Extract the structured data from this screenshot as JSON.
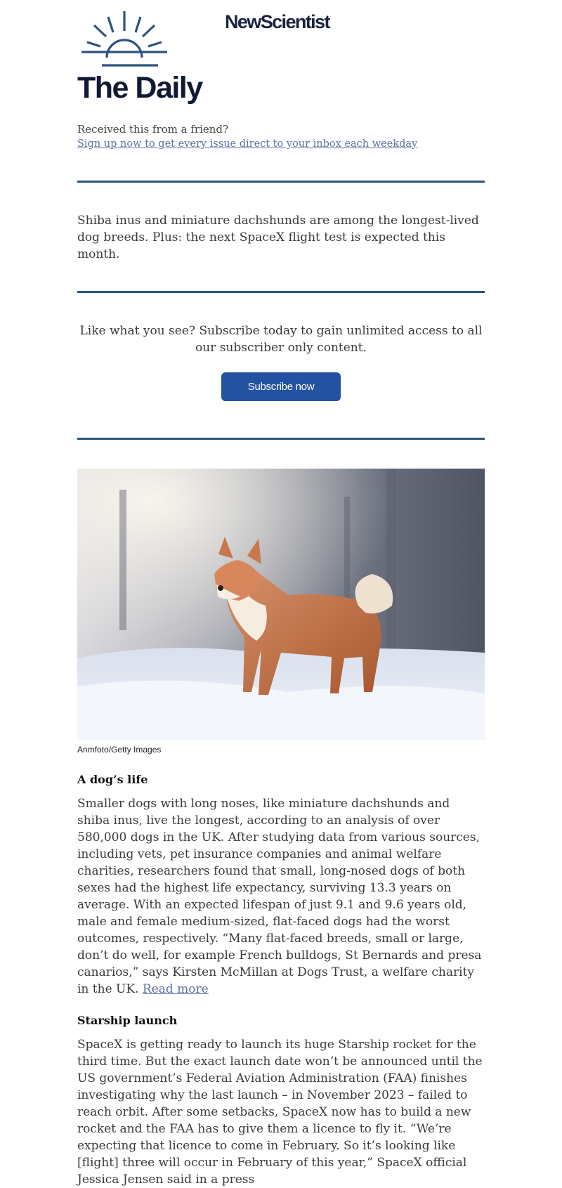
{
  "brand": {
    "name": "NewScientist",
    "logo_icon": "sunrise-icon",
    "accent": "#2b537e"
  },
  "newsletter": {
    "title": "The Daily"
  },
  "forward": {
    "question": "Received this from a friend?",
    "signup_link": "Sign up now to get every issue direct to your inbox each weekday"
  },
  "intro": "Shiba inus and miniature dachshunds are among the longest-lived dog breeds. Plus: the next SpaceX flight test is expected this month.",
  "subscribe": {
    "text": "Like what you see? Subscribe today to gain unlimited access to all our subscriber only content.",
    "button_label": "Subscribe now",
    "button_color": "#2352a2"
  },
  "hero": {
    "caption": "Anmfoto/Getty Images"
  },
  "stories": [
    {
      "headline": "A dog’s life",
      "body": "Smaller dogs with long noses, like miniature dachshunds and shiba inus, live the longest, according to an analysis of over 580,000 dogs in the UK. After studying data from various sources, including vets, pet insurance companies and animal welfare charities, researchers found that small, long-nosed dogs of both sexes had the highest life expectancy, surviving 13.3 years on average. With an expected lifespan of just 9.1 and 9.6 years old, male and female medium-sized, flat-faced dogs had the worst outcomes, respectively. “Many flat-faced breeds, small or large, don’t do well, for example French bulldogs, St Bernards and presa canarios,” says Kirsten McMillan at Dogs Trust, a welfare charity in the UK.",
      "read_more": "Read more"
    },
    {
      "headline": "Starship launch",
      "body": "SpaceX is getting ready to launch its huge Starship rocket for the third time. But the exact launch date won’t be announced until the US government’s Federal Aviation Administration (FAA) finishes investigating why the last launch – in November 2023 – failed to reach orbit. After some setbacks, SpaceX now has to build a new rocket and the FAA has to give them a licence to fly it. “We’re expecting that licence to come in February. So it’s looking like [flight] three will occur in February of this year,” SpaceX official Jessica Jensen said in a press"
    }
  ]
}
